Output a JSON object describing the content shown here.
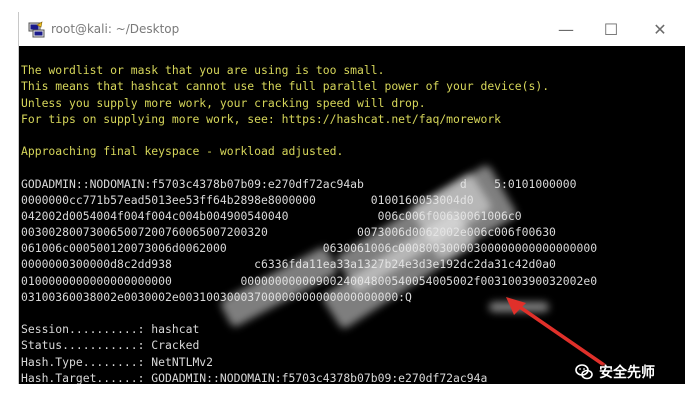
{
  "window": {
    "title": "root@kali: ~/Desktop",
    "minimize_glyph": "—",
    "maximize_glyph": "☐",
    "close_glyph": "✕"
  },
  "terminal": {
    "lines": [
      {
        "text": "",
        "color": "white"
      },
      {
        "text": "The wordlist or mask that you are using is too small.",
        "color": "yellow"
      },
      {
        "text": "This means that hashcat cannot use the full parallel power of your device(s).",
        "color": "yellow"
      },
      {
        "text": "Unless you supply more work, your cracking speed will drop.",
        "color": "yellow"
      },
      {
        "text": "For tips on supplying more work, see: https://hashcat.net/faq/morework",
        "color": "yellow"
      },
      {
        "text": "",
        "color": "white"
      },
      {
        "text": "Approaching final keyspace - workload adjusted.",
        "color": "yellow"
      },
      {
        "text": "",
        "color": "white"
      },
      {
        "text": "GODADMIN::NODOMAIN:f5703c4378b07b09:e270df72ac94ab              d    5:0101000000",
        "color": "white"
      },
      {
        "text": "0000000cc771b57ead5013ee53ff64b2898e8000000        0100160053004d0",
        "color": "white"
      },
      {
        "text": "042002d0054004f004f004c004b004900540040             006c006f00630061006c0",
        "color": "white"
      },
      {
        "text": "003002800730065007200760065007200320             0073006d0062002e006c006f00630",
        "color": "white"
      },
      {
        "text": "061006c000500120073006d0062000              0630061006c00080030000300000000000000000",
        "color": "white"
      },
      {
        "text": "0000000300000d8c2dd938            c6336fda11ea33a1327b24e3d3e192dc2da31c42d0a0",
        "color": "white"
      },
      {
        "text": "0100000000000000000000          0000000000090024004800540054005002f003100390032002e0",
        "color": "white"
      },
      {
        "text": "03100360038002e0030002e00310030003700000000000000000000:Q",
        "color": "white"
      },
      {
        "text": "",
        "color": "white"
      },
      {
        "text": "Session..........: hashcat",
        "color": "white"
      },
      {
        "text": "Status...........: Cracked",
        "color": "white"
      },
      {
        "text": "Hash.Type........: NetNTLMv2",
        "color": "white"
      },
      {
        "text": "Hash.Target......: GODADMIN::NODOMAIN:f5703c4378b07b09:e270df72ac94a",
        "color": "white"
      }
    ]
  },
  "watermark": {
    "text": "安全先师",
    "icon": "wechat-icon"
  },
  "annotation": {
    "arrow_color": "#e0302a"
  }
}
